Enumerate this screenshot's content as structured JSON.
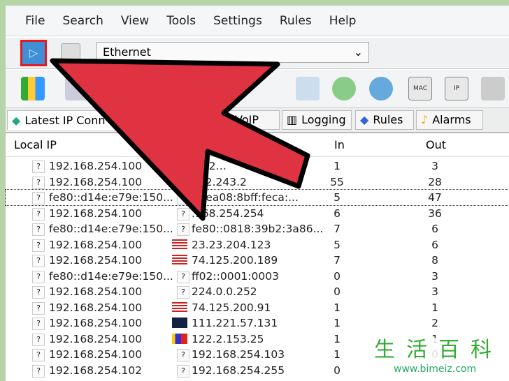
{
  "menu": [
    "File",
    "Search",
    "View",
    "Tools",
    "Settings",
    "Rules",
    "Help"
  ],
  "toolbar": {
    "play_icon": "play-icon",
    "stop_icon": "stop-icon",
    "adapter": "Ethernet",
    "mac_label": "MAC",
    "ip_label": "IP"
  },
  "tabs": [
    "Latest IP Conn",
    "VoIP",
    "Logging",
    "Rules",
    "Alarms"
  ],
  "columns": {
    "local": "Local IP",
    "in": "In",
    "out": "Out"
  },
  "rows": [
    {
      "local": "192.168.254.100",
      "remote": "71.2…",
      "flag": "?",
      "in": "1",
      "out": "3"
    },
    {
      "local": "192.168.254.100",
      "remote": "252.243.2",
      "flag": "?",
      "in": "55",
      "out": "28"
    },
    {
      "local": "fe80::d14e:e79e:150...",
      "remote": "0::ea08:8bff:feca:...",
      "flag": "?",
      "in": "5",
      "out": "47"
    },
    {
      "local": "192.168.254.100",
      "remote": ".168.254.254",
      "flag": "?",
      "in": "6",
      "out": "36"
    },
    {
      "local": "fe80::d14e:e79e:150...",
      "remote": "fe80::0818:39b2:3a86...",
      "flag": "?",
      "in": "7",
      "out": "6"
    },
    {
      "local": "192.168.254.100",
      "remote": "23.23.204.123",
      "flag": "us",
      "in": "5",
      "out": "6"
    },
    {
      "local": "192.168.254.100",
      "remote": "74.125.200.189",
      "flag": "us",
      "in": "7",
      "out": "8"
    },
    {
      "local": "fe80::d14e:e79e:150...",
      "remote": "ff02::0001:0003",
      "flag": "?",
      "in": "0",
      "out": "3"
    },
    {
      "local": "192.168.254.100",
      "remote": "224.0.0.252",
      "flag": "?",
      "in": "0",
      "out": "3"
    },
    {
      "local": "192.168.254.100",
      "remote": "74.125.200.91",
      "flag": "us",
      "in": "1",
      "out": "1"
    },
    {
      "local": "192.168.254.100",
      "remote": "111.221.57.131",
      "flag": "au",
      "in": "1",
      "out": "2"
    },
    {
      "local": "192.168.254.100",
      "remote": "122.2.153.25",
      "flag": "ph",
      "in": "1",
      "out": "1"
    },
    {
      "local": "192.168.254.100",
      "remote": "192.168.254.103",
      "flag": "?",
      "in": "1",
      "out": "0"
    },
    {
      "local": "192.168.254.102",
      "remote": "192.168.254.255",
      "flag": "?",
      "in": "0",
      "out": ""
    }
  ],
  "colors": {
    "arrow": "#e03342",
    "highlight": "#e21b22"
  },
  "watermark": {
    "chars": "生活百科",
    "url": "www.bimeiz.com"
  }
}
